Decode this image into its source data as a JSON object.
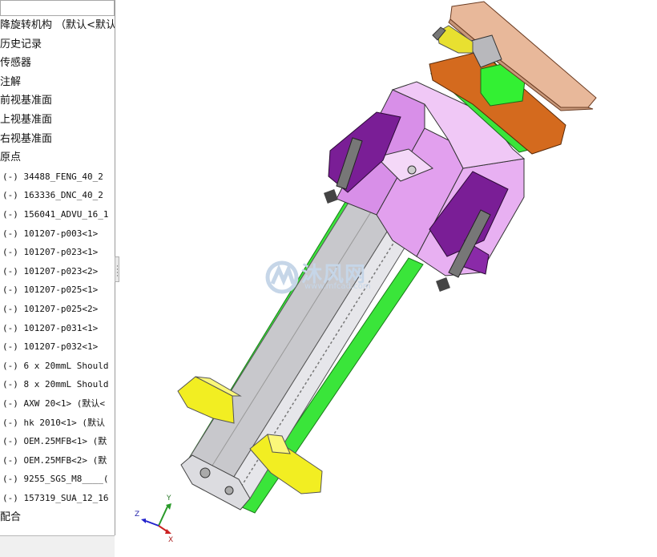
{
  "feature_tree": {
    "items": [
      {
        "label": "降旋转机构  （默认<默认"
      },
      {
        "label": "历史记录"
      },
      {
        "label": "传感器"
      },
      {
        "label": "注解"
      },
      {
        "label": "前视基准面"
      },
      {
        "label": "上视基准面"
      },
      {
        "label": "右视基准面"
      },
      {
        "label": "原点"
      },
      {
        "label": "(-) 34488_FENG_40_2"
      },
      {
        "label": "(-) 163336_DNC_40_2"
      },
      {
        "label": "(-) 156041_ADVU_16_1"
      },
      {
        "label": "(-) 101207-p003<1>"
      },
      {
        "label": "(-) 101207-p023<1>"
      },
      {
        "label": "(-) 101207-p023<2>"
      },
      {
        "label": "(-) 101207-p025<1>"
      },
      {
        "label": "(-) 101207-p025<2>"
      },
      {
        "label": "(-) 101207-p031<1>"
      },
      {
        "label": "(-) 101207-p032<1>"
      },
      {
        "label": "(-) 6 x 20mmL Should"
      },
      {
        "label": "(-) 8 x 20mmL Should"
      },
      {
        "label": "(-) AXW 20<1> (默认<"
      },
      {
        "label": "(-) hk 2010<1> (默认"
      },
      {
        "label": "(-) OEM.25MFB<1> (默"
      },
      {
        "label": "(-) OEM.25MFB<2> (默"
      },
      {
        "label": "(-) 9255_SGS_M8____("
      },
      {
        "label": "(-) 157319_SUA_12_16"
      },
      {
        "label": "配合"
      }
    ]
  },
  "watermark": {
    "text": "沐风网",
    "url": "www.mfcad.com"
  },
  "triad": {
    "x_label": "X",
    "y_label": "Y",
    "z_label": "Z"
  },
  "colors": {
    "green": "#33ee33",
    "pink": "#e2a0ee",
    "purple": "#7a1e96",
    "orange": "#d46a1e",
    "copper": "#e8b89a",
    "yellow": "#f2ee22",
    "rail": "#e2e2e4"
  }
}
